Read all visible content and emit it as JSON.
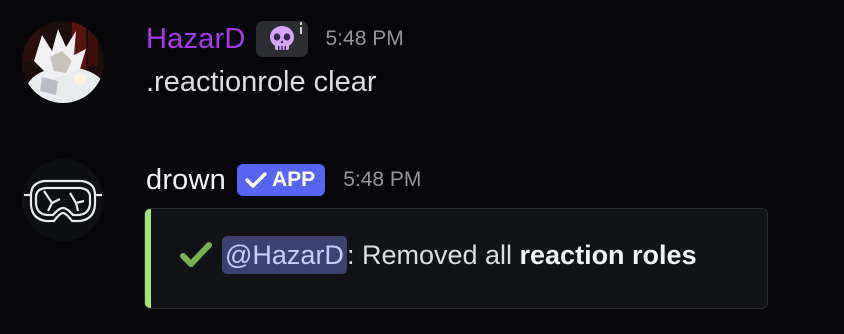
{
  "colors": {
    "background": "#070709",
    "hazard_name": "#a63af0",
    "drown_name": "#f2f3f5",
    "app_tag": "#5865f2",
    "embed_accent": "#a6e37a",
    "checkmark": "#77b255",
    "mention_bg": "#3c4270"
  },
  "messages": [
    {
      "author": "HazarD",
      "badge_icon": "skull-icon",
      "timestamp": "5:48 PM",
      "content": ".reactionrole clear"
    },
    {
      "author": "drown",
      "tag": "APP",
      "timestamp": "5:48 PM",
      "embed": {
        "icon": "heavy-check-mark-icon",
        "mention": "@HazarD",
        "text": ": Removed all ",
        "bold_text": "reaction roles"
      }
    }
  ]
}
